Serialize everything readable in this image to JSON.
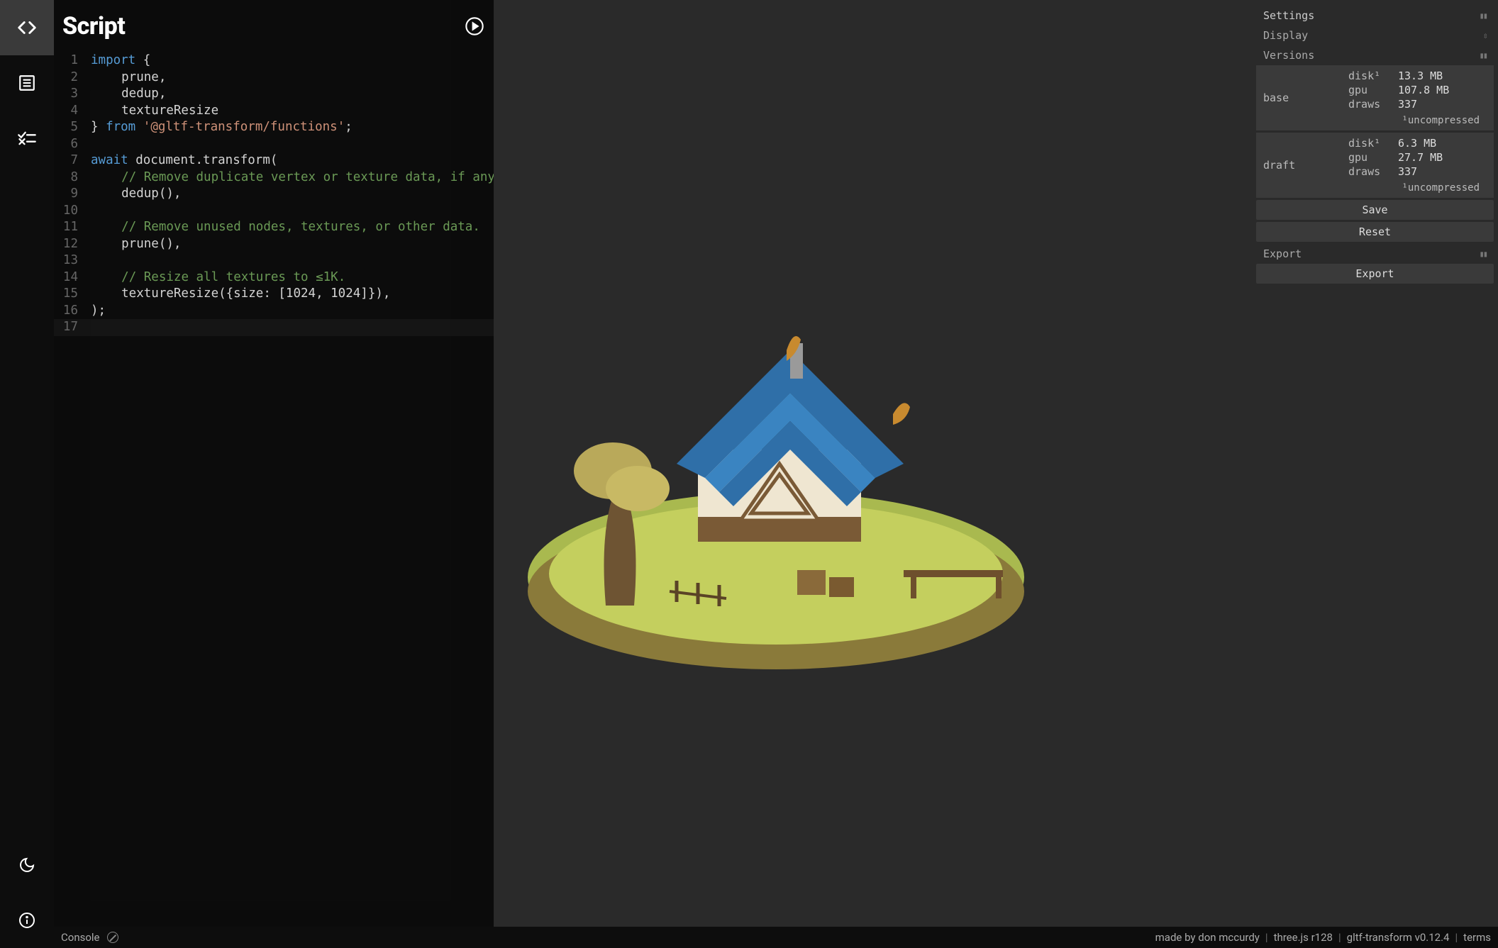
{
  "sidebar": {
    "items": [
      {
        "name": "script",
        "icon": "code"
      },
      {
        "name": "list",
        "icon": "list"
      },
      {
        "name": "checklist",
        "icon": "tasks"
      }
    ],
    "bottom": [
      {
        "name": "theme",
        "icon": "moon"
      },
      {
        "name": "info",
        "icon": "info"
      }
    ]
  },
  "script": {
    "title": "Script",
    "run_tooltip": "Run",
    "lines": [
      {
        "n": 1,
        "tokens": [
          {
            "t": "import",
            "c": "kw"
          },
          {
            "t": " {",
            "c": "pl"
          }
        ],
        "indent": 0
      },
      {
        "n": 2,
        "tokens": [
          {
            "t": "    prune,",
            "c": "pl"
          }
        ],
        "indent": 1
      },
      {
        "n": 3,
        "tokens": [
          {
            "t": "    dedup,",
            "c": "pl"
          }
        ],
        "indent": 1
      },
      {
        "n": 4,
        "tokens": [
          {
            "t": "    textureResize",
            "c": "pl"
          }
        ],
        "indent": 1
      },
      {
        "n": 5,
        "tokens": [
          {
            "t": "} ",
            "c": "pl"
          },
          {
            "t": "from",
            "c": "kw"
          },
          {
            "t": " ",
            "c": "pl"
          },
          {
            "t": "'@gltf-transform/functions'",
            "c": "str"
          },
          {
            "t": ";",
            "c": "pl"
          }
        ],
        "indent": 0
      },
      {
        "n": 6,
        "tokens": [
          {
            "t": "",
            "c": "pl"
          }
        ],
        "indent": 0
      },
      {
        "n": 7,
        "tokens": [
          {
            "t": "await",
            "c": "kw"
          },
          {
            "t": " document.transform(",
            "c": "pl"
          }
        ],
        "indent": 0
      },
      {
        "n": 8,
        "tokens": [
          {
            "t": "    ",
            "c": "pl"
          },
          {
            "t": "// Remove duplicate vertex or texture data, if any.",
            "c": "cm"
          }
        ],
        "indent": 1
      },
      {
        "n": 9,
        "tokens": [
          {
            "t": "    dedup(),",
            "c": "pl"
          }
        ],
        "indent": 1
      },
      {
        "n": 10,
        "tokens": [
          {
            "t": "",
            "c": "pl"
          }
        ],
        "indent": 1
      },
      {
        "n": 11,
        "tokens": [
          {
            "t": "    ",
            "c": "pl"
          },
          {
            "t": "// Remove unused nodes, textures, or other data.",
            "c": "cm"
          }
        ],
        "indent": 1
      },
      {
        "n": 12,
        "tokens": [
          {
            "t": "    prune(),",
            "c": "pl"
          }
        ],
        "indent": 1
      },
      {
        "n": 13,
        "tokens": [
          {
            "t": "",
            "c": "pl"
          }
        ],
        "indent": 1
      },
      {
        "n": 14,
        "tokens": [
          {
            "t": "    ",
            "c": "pl"
          },
          {
            "t": "// Resize all textures to ≤1K.",
            "c": "cm"
          }
        ],
        "indent": 1
      },
      {
        "n": 15,
        "tokens": [
          {
            "t": "    textureResize({size: [1024, 1024]}),",
            "c": "pl"
          }
        ],
        "indent": 1
      },
      {
        "n": 16,
        "tokens": [
          {
            "t": ");",
            "c": "pl"
          }
        ],
        "indent": 0
      },
      {
        "n": 17,
        "tokens": [
          {
            "t": "",
            "c": "pl"
          }
        ],
        "indent": 0,
        "current": true
      }
    ]
  },
  "rightPanel": {
    "settings_label": "Settings",
    "display_label": "Display",
    "versions_label": "Versions",
    "export_section_label": "Export",
    "note": "¹uncompressed",
    "buttons": {
      "save": "Save",
      "reset": "Reset",
      "export": "Export"
    },
    "versions": [
      {
        "name": "base",
        "metrics": [
          {
            "k": "disk¹",
            "v": "13.3 MB"
          },
          {
            "k": "gpu",
            "v": "107.8 MB"
          },
          {
            "k": "draws",
            "v": "337"
          }
        ]
      },
      {
        "name": "draft",
        "metrics": [
          {
            "k": "disk¹",
            "v": "6.3 MB"
          },
          {
            "k": "gpu",
            "v": "27.7 MB"
          },
          {
            "k": "draws",
            "v": "337"
          }
        ]
      }
    ]
  },
  "statusbar": {
    "console": "Console",
    "credits": "made by don mccurdy",
    "threejs": "three.js r128",
    "gltf": "gltf-transform v0.12.4",
    "terms": "terms"
  }
}
